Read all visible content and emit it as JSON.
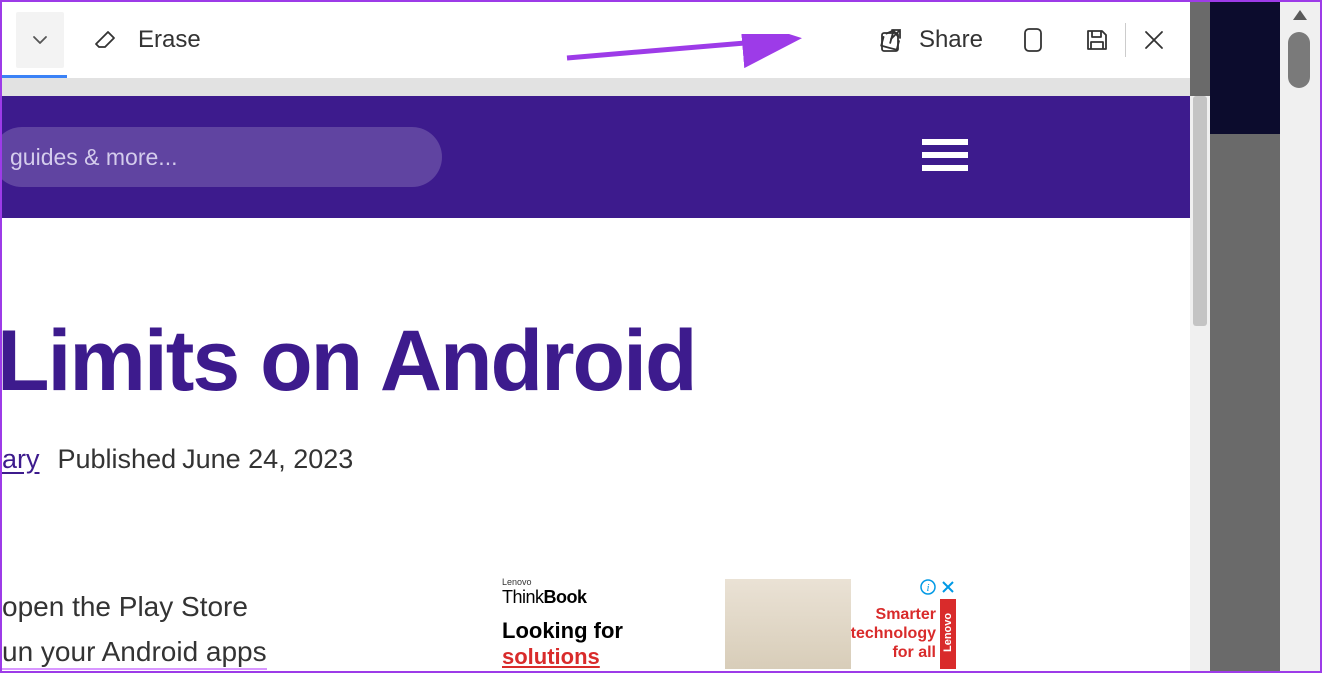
{
  "toolbar": {
    "erase_label": "Erase",
    "share_label": "Share"
  },
  "page": {
    "search_placeholder": "guides & more...",
    "article_title": "Limits on Android",
    "author_fragment": "ary",
    "publish_prefix": "Published",
    "publish_date": "June 24, 2023",
    "body_line1": "open the Play Store",
    "body_line2": "un your Android apps"
  },
  "ad": {
    "lenovo_small": "Lenovo",
    "think_thin": "Think",
    "think_bold": "Book",
    "looking_black": "Looking for",
    "looking_red": "solutions",
    "tagline1": "Smarter",
    "tagline2": "technology",
    "tagline3": "for all",
    "brand": "Lenovo"
  },
  "colors": {
    "accent": "#9d3be8",
    "brand_purple": "#3d1b8d",
    "ad_red": "#d92b2b"
  }
}
